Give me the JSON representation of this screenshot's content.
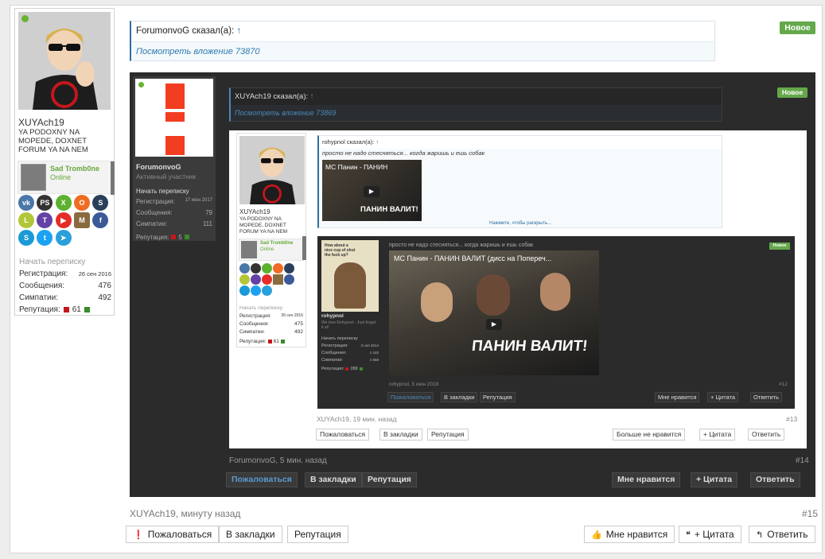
{
  "user": {
    "name": "XUYAch19",
    "title": "YA PODOXNY NA MOPEDE, DOXNET FORUM YA NA NEM",
    "friend": {
      "name": "Sad Tromb0ne",
      "status": "Online"
    },
    "social_icons": [
      "vk-icon",
      "playstation-icon",
      "xbox-icon",
      "origin-icon",
      "steam-icon",
      "battlenet-icon",
      "twitch-icon",
      "youtube-icon",
      "minecraft-icon",
      "facebook-icon",
      "skype-icon",
      "twitter-icon",
      "telegram-icon"
    ],
    "start_conversation": "Начать переписку",
    "stats": [
      {
        "label": "Регистрация:",
        "value": "26 сен 2016"
      },
      {
        "label": "Сообщения:",
        "value": "476"
      },
      {
        "label": "Симпатии:",
        "value": "492"
      },
      {
        "label": "Репутация:",
        "value": "61"
      }
    ]
  },
  "quote": {
    "author": "ForumonvoG сказал(а):",
    "arrow": "↑",
    "attachment": "Посмотреть вложение 73870"
  },
  "badge": "Новое",
  "embedded": {
    "user": {
      "name": "ForumonvoG",
      "title": "Активный участник",
      "start_conversation": "Начать переписку",
      "stats": [
        {
          "label": "Регистрация:",
          "value": "17 июн 2017"
        },
        {
          "label": "Сообщения:",
          "value": "79"
        },
        {
          "label": "Симпатии:",
          "value": "111"
        },
        {
          "label": "Репутация:",
          "value": "5"
        }
      ]
    },
    "quote": {
      "author": "XUYAch19 сказал(а):",
      "arrow": "↑",
      "attachment": "Посмотреть вложение 73869"
    },
    "badge": "Новое",
    "inner": {
      "user_name": "XUYAch19",
      "user_title": "YA PODOXNY NA MOPEDE, DOXNET FORUM YA NA NEM",
      "friend_name": "Sad Tromb0ne",
      "friend_status": "Online",
      "start_conversation": "Начать переписку",
      "stats": [
        {
          "label": "Регистрация:",
          "value": "26 сен 2016"
        },
        {
          "label": "Сообщения:",
          "value": "475"
        },
        {
          "label": "Симпатии:",
          "value": "492"
        },
        {
          "label": "Репутация:",
          "value": "61"
        }
      ],
      "quote_author": "rohypnol сказал(а):",
      "quote_arrow": "↑",
      "quote_text": "просто не надо стесняться... когда жаришь и ешь собак",
      "video_title_small": "МС Панин - ПАНИН",
      "video_caption_small": "ПАНИН ВАЛИТ!",
      "expand": "Нажмите, чтобы раскрыть...",
      "deep": {
        "user_name": "rohypnol",
        "user_title": "We love Rohypnol - Just forget it all",
        "poster_text": "How about a nice cup of shut the fuck up?",
        "start_conversation": "Начать переписку",
        "stats": [
          {
            "label": "Регистрация:",
            "value": "3 ноя 2014"
          },
          {
            "label": "Сообщения:",
            "value": "1 240"
          },
          {
            "label": "Симпатии:",
            "value": "1 658"
          },
          {
            "label": "Репутация:",
            "value": "288"
          }
        ],
        "text": "просто не надо стесняться... когда жаришь и ешь собак",
        "badge": "Новое",
        "video_title": "МС Панин - ПАНИН ВАЛИТ (дисс на Попереч...",
        "video_caption": "ПАНИН ВАЛИТ!",
        "footer": "rohypnol, 5 июн 2018",
        "number": "#12",
        "buttons_left": [
          "Пожаловаться",
          "В закладки",
          "Репутация"
        ],
        "buttons_right": [
          "Мне нравится",
          "+ Цитата",
          "Ответить"
        ]
      },
      "footer": "XUYAch19, 19 мин. назад",
      "number": "#13",
      "buttons_left": [
        "Пожаловаться",
        "В закладки",
        "Репутация"
      ],
      "buttons_right": [
        "Больше не нравится",
        "+ Цитата",
        "Ответить"
      ]
    },
    "footer": "ForumonvoG, 5 мин. назад",
    "number": "#14",
    "buttons_left": [
      "Пожаловаться",
      "В закладки",
      "Репутация"
    ],
    "buttons_right": [
      "Мне нравится",
      "+ Цитата",
      "Ответить"
    ]
  },
  "footer": {
    "author_time": "XUYAch19, минуту назад",
    "number": "#15"
  },
  "actions_left": {
    "report": "Пожаловаться",
    "bookmark": "В закладки",
    "reputation": "Репутация"
  },
  "actions_right": {
    "like": "Мне нравится",
    "quote": "+ Цитата",
    "reply": "Ответить"
  },
  "colors": {
    "accent": "#2d6ea0",
    "new_badge": "#63a84a",
    "online": "#67b430",
    "dark_bg": "#2b2b2b"
  }
}
